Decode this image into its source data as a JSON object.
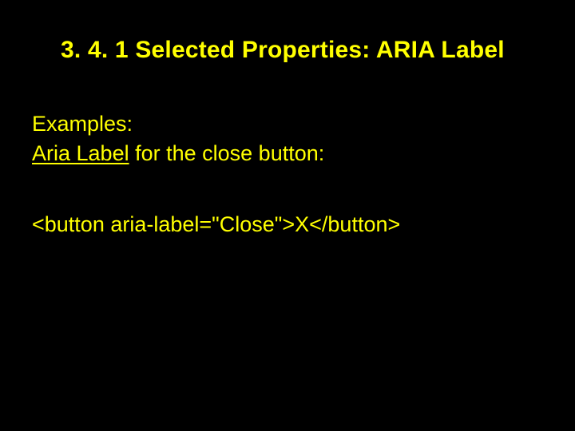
{
  "slide": {
    "title": "3. 4. 1 Selected Properties:  ARIA Label",
    "examples_label": "Examples:",
    "aria_label_underlined": "Aria Label",
    "aria_label_rest": " for the close button:",
    "code_example": "<button aria-label=\"Close\">X</button>"
  }
}
